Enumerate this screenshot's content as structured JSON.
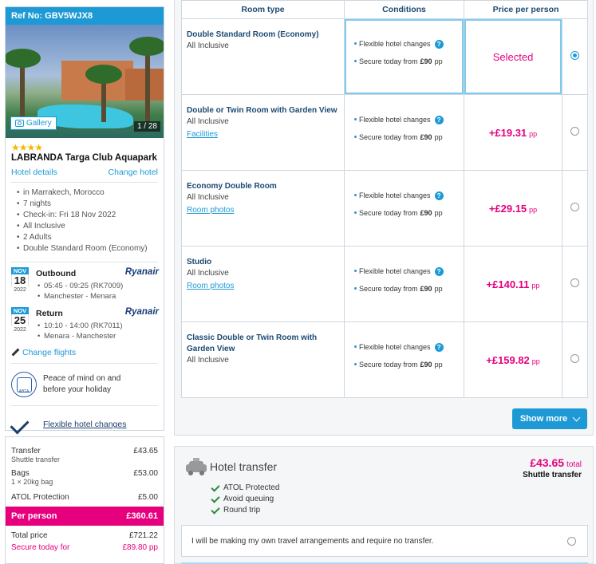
{
  "booking": {
    "ref_label": "Ref No: GBV5WJX8"
  },
  "hotel": {
    "gallery_label": "Gallery",
    "image_counter": "1 / 28",
    "stars": "★★★★",
    "rating": 4,
    "name": "LABRANDA Targa Club Aquapark",
    "details_link": "Hotel details",
    "change_link": "Change hotel",
    "details": [
      "in Marrakech, Morocco",
      "7 nights",
      "Check-in: Fri 18 Nov 2022",
      "All Inclusive",
      "2 Adults",
      "Double Standard Room (Economy)"
    ]
  },
  "flights": {
    "outbound": {
      "month": "NOV",
      "day": "18",
      "year": "2022",
      "title": "Outbound",
      "airline": "Ryanair",
      "times": "05:45 - 09:25 (RK7009)",
      "route": "Manchester - Menara"
    },
    "return": {
      "month": "NOV",
      "day": "25",
      "year": "2022",
      "title": "Return",
      "airline": "Ryanair",
      "times": "10:10 - 14:00 (RK7011)",
      "route": "Menara - Manchester"
    },
    "change_link": "Change flights"
  },
  "assurance": {
    "line1": "Peace of mind on and",
    "line2": "before your holiday",
    "flexible_link": "Flexible hotel changes"
  },
  "summary": {
    "transfer_label": "Transfer",
    "transfer_value": "£43.65",
    "transfer_sub": "Shuttle transfer",
    "bags_label": "Bags",
    "bags_value": "£53.00",
    "bags_sub": "1 × 20kg bag",
    "atol_label": "ATOL Protection",
    "atol_value": "£5.00",
    "per_person_label": "Per person",
    "per_person_value": "£360.61",
    "total_label": "Total price",
    "total_value": "£721.22",
    "secure_label": "Secure today for",
    "secure_value": "£89.80 pp"
  },
  "rooms_table": {
    "headers": [
      "Room type",
      "Conditions",
      "Price per person"
    ],
    "condition_1": "Flexible hotel changes",
    "condition_2_prefix": "Secure today from ",
    "condition_2_amount": "£90",
    "condition_2_suffix": " pp",
    "rows": [
      {
        "name": "Double Standard Room (Economy)",
        "board": "All Inclusive",
        "link": "",
        "price": "Selected",
        "pp": "",
        "selected": true
      },
      {
        "name": "Double or Twin Room with Garden View",
        "board": "All Inclusive",
        "link": "Facilities",
        "price": "+£19.31",
        "pp": "pp",
        "selected": false
      },
      {
        "name": "Economy Double Room",
        "board": "All Inclusive",
        "link": "Room photos",
        "price": "+£29.15",
        "pp": "pp",
        "selected": false
      },
      {
        "name": "Studio",
        "board": "All Inclusive",
        "link": "Room photos",
        "price": "+£140.11",
        "pp": "pp",
        "selected": false
      },
      {
        "name": "Classic Double or Twin Room with Garden View",
        "board": "All Inclusive",
        "link": "",
        "price": "+£159.82",
        "pp": "pp",
        "selected": false
      }
    ],
    "show_more": "Show more"
  },
  "transfer": {
    "title": "Hotel transfer",
    "price": "£43.65",
    "price_suffix": "total",
    "type": "Shuttle transfer",
    "features": [
      "ATOL Protected",
      "Avoid queuing",
      "Round trip"
    ],
    "no_transfer_text": "I will be making my own travel arrangements and require no transfer."
  },
  "colors": {
    "accent_blue": "#1d9ad6",
    "price_pink": "#e6007e",
    "heading_navy": "#1c4a72"
  }
}
